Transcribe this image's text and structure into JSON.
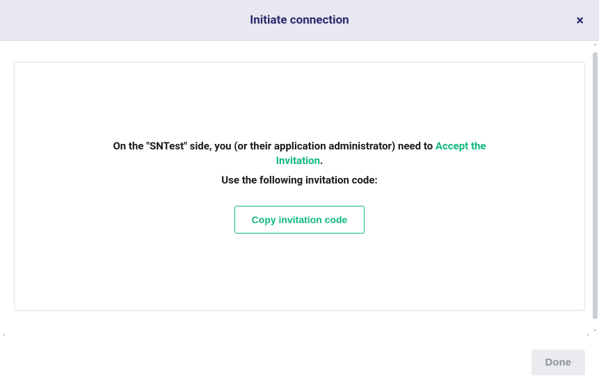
{
  "header": {
    "title": "Initiate connection",
    "close": "×"
  },
  "panel": {
    "instruction_before": "On the \"SNTest\" side, you (or their application administrator) need to ",
    "accept_link": "Accept the Invitation",
    "instruction_after": ".",
    "sub_instruction": "Use the following invitation code:",
    "copy_button": "Copy invitation code"
  },
  "footer": {
    "done": "Done"
  },
  "scroll": {
    "up": "⌃",
    "down": "⌄",
    "left": "‹",
    "right": "›"
  }
}
